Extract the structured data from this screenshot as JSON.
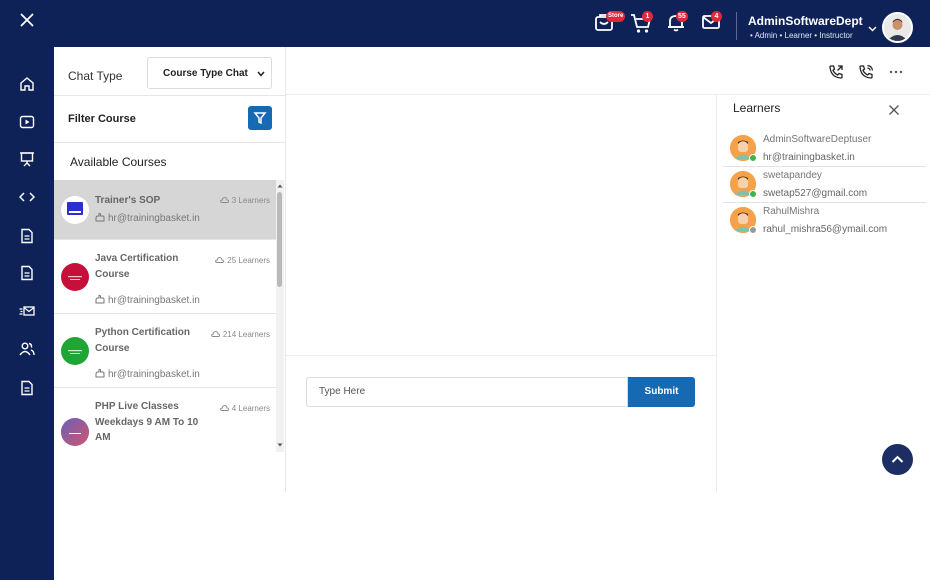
{
  "topbar": {
    "store_badge": "Store",
    "cart_badge": "1",
    "bell_badge": "55",
    "mail_badge": "4",
    "user_name": "AdminSoftwareDept",
    "user_roles": "• Admin • Learner • Instructor",
    "bg_color": "#0e2257"
  },
  "course_panel": {
    "chat_type_label": "Chat Type",
    "chat_type_value": "Course Type Chat",
    "filter_label": "Filter Course",
    "available_label": "Available Courses",
    "courses": [
      {
        "title": "Trainer's SOP",
        "learners": "3 Learners",
        "email": "hr@trainingbasket.in",
        "logo_color": "#2b2fd0"
      },
      {
        "title": "Java Certification Course",
        "learners": "25 Learners",
        "email": "hr@trainingbasket.in",
        "logo_color": "#c4103a"
      },
      {
        "title": "Python Certification Course",
        "learners": "214 Learners",
        "email": "hr@trainingbasket.in",
        "logo_color": "#1fa534"
      },
      {
        "title": "PHP Live Classes Weekdays 9 AM To 10 AM",
        "learners": "4 Learners",
        "email": "hr@trainingbasket.in",
        "logo_color": "#6a5fb8"
      }
    ]
  },
  "chat": {
    "input_placeholder": "Type Here",
    "submit_label": "Submit",
    "accent": "#1669b3"
  },
  "learners": {
    "title": "Learners",
    "items": [
      {
        "name": "AdminSoftwareDeptuser",
        "email": "hr@trainingbasket.in",
        "status_color": "#3cb54a"
      },
      {
        "name": "swetapandey",
        "email": "swetap527@gmail.com",
        "status_color": "#3cb54a"
      },
      {
        "name": "RahulMishra",
        "email": "rahul_mishra56@ymail.com",
        "status_color": "#9a9a9a"
      }
    ]
  }
}
